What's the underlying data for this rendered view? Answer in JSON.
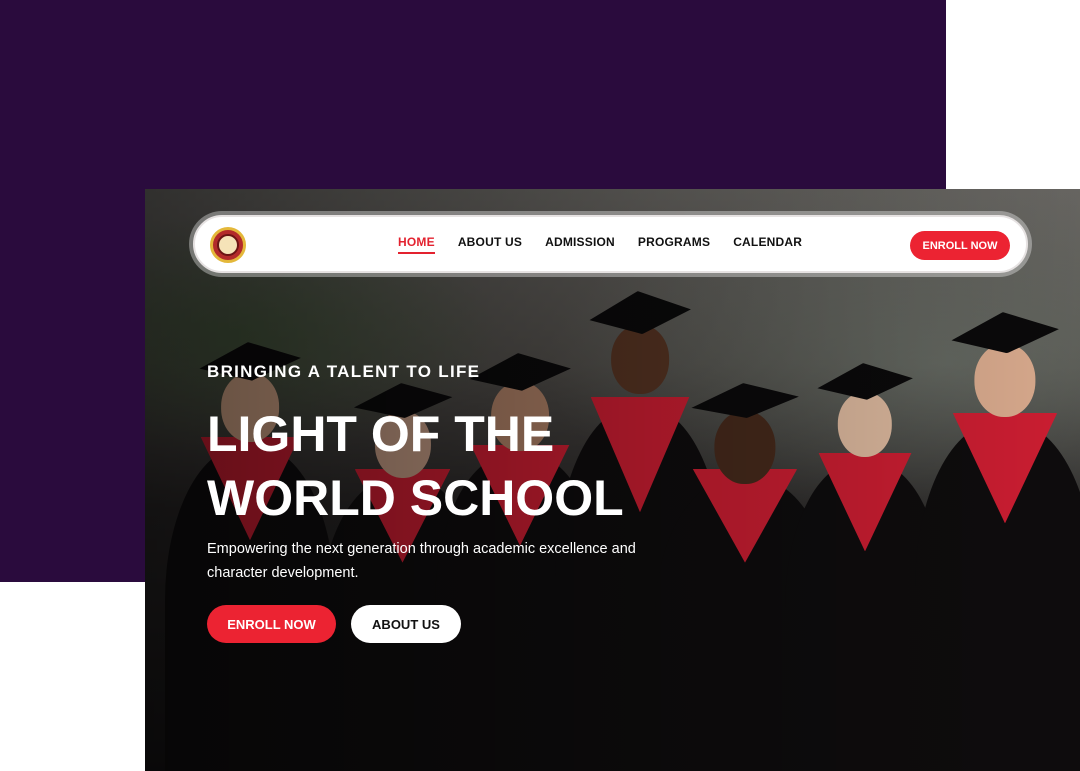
{
  "brand": {
    "logo_icon": "school-crest-icon"
  },
  "nav": {
    "items": [
      {
        "label": "HOME",
        "active": true
      },
      {
        "label": "ABOUT US",
        "active": false
      },
      {
        "label": "ADMISSION",
        "active": false
      },
      {
        "label": "PROGRAMS",
        "active": false
      },
      {
        "label": "CALENDAR",
        "active": false
      }
    ],
    "cta_label": "ENROLL NOW"
  },
  "hero": {
    "tagline": "BRINGING A TALENT TO LIFE",
    "title_line1": "LIGHT OF THE",
    "title_line2": "WORLD SCHOOL",
    "subtitle": "Empowering the next generation through academic excellence and character development.",
    "primary_button": "ENROLL NOW",
    "secondary_button": "ABOUT US"
  },
  "colors": {
    "accent": "#ec2332",
    "backdrop": "#2a0b3d",
    "nav_background": "#ffffff"
  }
}
